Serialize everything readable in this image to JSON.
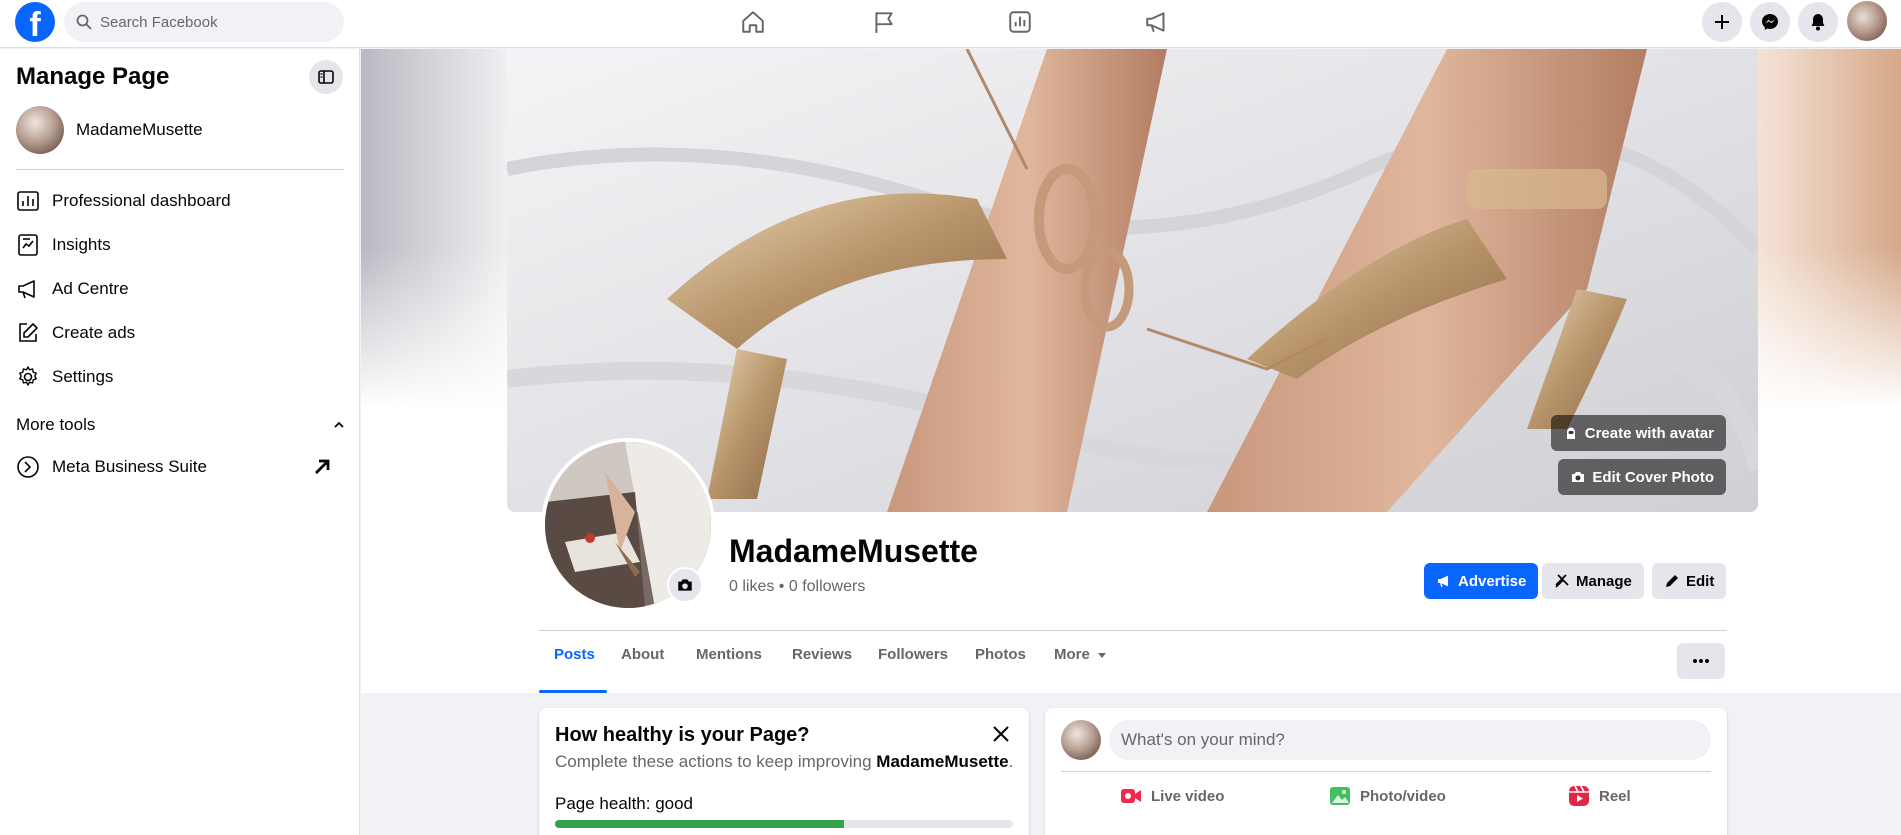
{
  "topbar": {
    "logo": "f",
    "search_placeholder": "Search Facebook",
    "nav_icons": [
      "home-icon",
      "flag-icon",
      "insights-icon",
      "megaphone-icon"
    ],
    "right_icons": [
      "plus-icon",
      "messenger-icon",
      "notifications-icon"
    ]
  },
  "sidebar": {
    "title": "Manage Page",
    "page_name": "MadameMusette",
    "items": [
      {
        "label": "Professional dashboard",
        "icon": "dashboard-icon"
      },
      {
        "label": "Insights",
        "icon": "insights-icon"
      },
      {
        "label": "Ad Centre",
        "icon": "megaphone-icon"
      },
      {
        "label": "Create ads",
        "icon": "pencil-square-icon"
      },
      {
        "label": "Settings",
        "icon": "gear-icon"
      }
    ],
    "more_tools": "More tools",
    "tools": [
      {
        "label": "Meta Business Suite",
        "icon": "meta-icon"
      }
    ]
  },
  "cover": {
    "create_avatar": "Create with avatar",
    "edit_cover": "Edit Cover Photo"
  },
  "page": {
    "name": "MadameMusette",
    "stats": "0 likes • 0 followers",
    "advertise": "Advertise",
    "manage": "Manage",
    "edit": "Edit"
  },
  "tabs": [
    "Posts",
    "About",
    "Mentions",
    "Reviews",
    "Followers",
    "Photos",
    "More"
  ],
  "health": {
    "title": "How healthy is your Page?",
    "desc_prefix": "Complete these actions to keep improving ",
    "desc_name": "MadameMusette",
    "desc_suffix": ".",
    "label": "Page health: good",
    "progress": 0.63
  },
  "composer": {
    "placeholder": "What's on your mind?",
    "actions": [
      "Live video",
      "Photo/video",
      "Reel"
    ]
  },
  "colors": {
    "brand": "#0866ff",
    "health_green": "#31a24c",
    "live_red": "#f02849",
    "photo_green": "#45bd62",
    "reel_pink": "#e42645"
  }
}
